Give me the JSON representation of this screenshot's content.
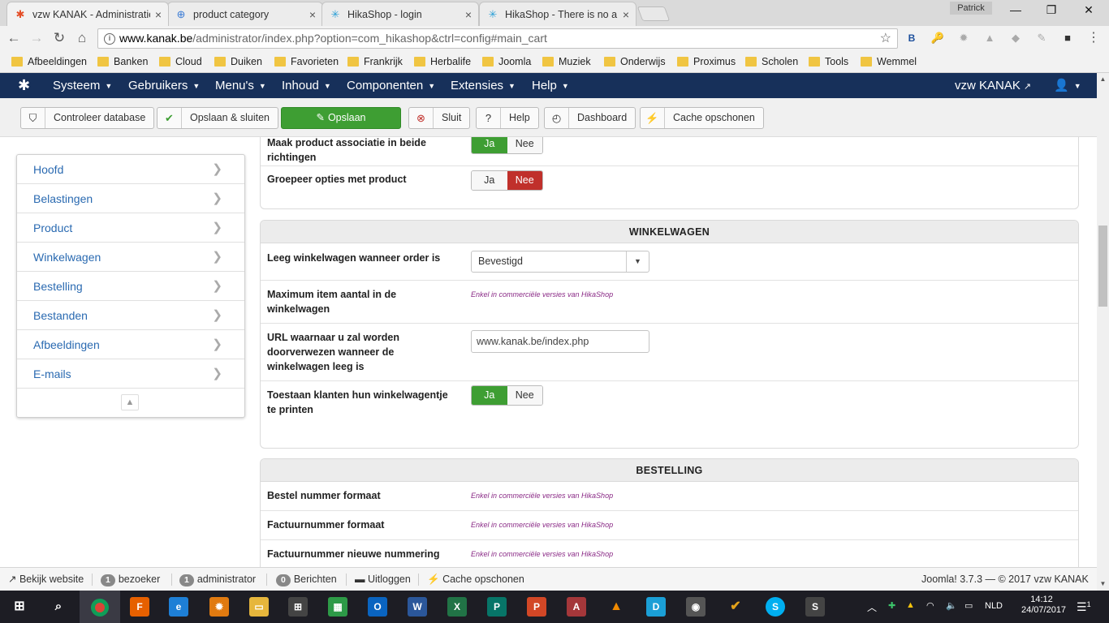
{
  "browser": {
    "tabs": [
      {
        "title": "vzw KANAK - Administratie",
        "icon": "joomla-icon",
        "active": true
      },
      {
        "title": "product category",
        "icon": "page-icon",
        "active": false
      },
      {
        "title": "HikaShop - login",
        "icon": "hikashop-icon",
        "active": false
      },
      {
        "title": "HikaShop - There is no a",
        "icon": "hikashop-icon",
        "active": false
      }
    ],
    "profile": "Patrick",
    "url_host": "www.kanak.be",
    "url_path": "/administrator/index.php?option=com_hikashop&ctrl=config#main_cart",
    "bookmarks": [
      "Afbeeldingen",
      "Banken",
      "Cloud",
      "Duiken",
      "Favorieten",
      "Frankrijk",
      "Herbalife",
      "Joomla",
      "Muziek",
      "Onderwijs",
      "Proximus",
      "Scholen",
      "Tools",
      "Wemmel"
    ]
  },
  "joomla": {
    "menu": [
      "Systeem",
      "Gebruikers",
      "Menu's",
      "Inhoud",
      "Componenten",
      "Extensies",
      "Help"
    ],
    "site_name": "vzw KANAK",
    "toolbar": {
      "check_db": "Controleer database",
      "save_close": "Opslaan & sluiten",
      "save": "Opslaan",
      "close": "Sluit",
      "help": "Help",
      "dashboard": "Dashboard",
      "clear_cache": "Cache opschonen"
    },
    "sidebar": [
      "Hoofd",
      "Belastingen",
      "Product",
      "Winkelwagen",
      "Bestelling",
      "Bestanden",
      "Afbeeldingen",
      "E-mails"
    ],
    "top_panel": {
      "partial_label": "Maak product associatie in beide richtingen",
      "partial_value": {
        "yes": "Ja",
        "no": "Nee"
      },
      "group_label": "Groepeer opties met product",
      "group_value": {
        "yes": "Ja",
        "no": "Nee",
        "selected": "Nee"
      }
    },
    "cart_panel": {
      "title": "WINKELWAGEN",
      "empty_cart_label": "Leeg winkelwagen wanneer order is",
      "empty_cart_value": "Bevestigd",
      "max_items_label": "Maximum item aantal in de winkelwagen",
      "commercial_note": "Enkel in commerciële versies van HikaShop",
      "redirect_label": "URL waarnaar u zal worden doorverwezen wanneer de winkelwagen leeg is",
      "redirect_value": "www.kanak.be/index.php",
      "print_label": "Toestaan klanten hun winkelwagentje te printen",
      "print_value": {
        "yes": "Ja",
        "no": "Nee",
        "selected": "Ja"
      }
    },
    "order_panel": {
      "title": "BESTELLING",
      "rows": [
        {
          "label": "Bestel nummer formaat",
          "note": "Enkel in commerciële versies van HikaShop"
        },
        {
          "label": "Factuurnummer formaat",
          "note": "Enkel in commerciële versies van HikaShop"
        },
        {
          "label": "Factuurnummer nieuwe nummering",
          "note": "Enkel in commerciële versies van HikaShop"
        }
      ]
    },
    "statusbar": {
      "view_site": "Bekijk website",
      "visitors_count": "1",
      "visitors": "bezoeker",
      "admins_count": "1",
      "admins": "administrator",
      "messages_count": "0",
      "messages": "Berichten",
      "logout": "Uitloggen",
      "clear_cache": "Cache opschonen",
      "version": "Joomla! 3.7.3 — © 2017 vzw KANAK"
    }
  },
  "taskbar": {
    "language": "NLD",
    "time": "14:12",
    "date": "24/07/2017",
    "notifications": "1"
  },
  "colors": {
    "joomla_nav": "#17305a",
    "save_green": "#3e9e33",
    "toggle_red": "#c0302b",
    "link_blue": "#2a6ab1",
    "note_purple": "#8a2a86"
  }
}
